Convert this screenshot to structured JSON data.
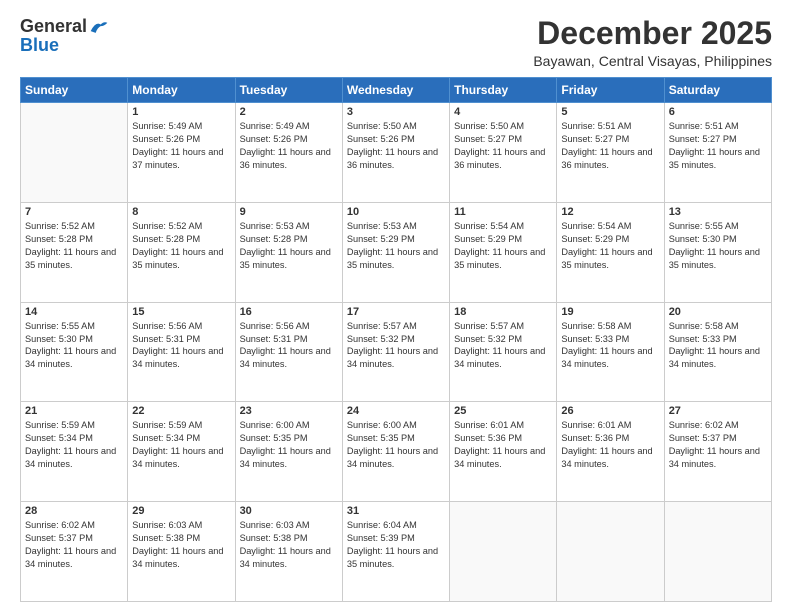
{
  "header": {
    "logo_general": "General",
    "logo_blue": "Blue",
    "month_title": "December 2025",
    "subtitle": "Bayawan, Central Visayas, Philippines"
  },
  "weekdays": [
    "Sunday",
    "Monday",
    "Tuesday",
    "Wednesday",
    "Thursday",
    "Friday",
    "Saturday"
  ],
  "weeks": [
    [
      {
        "day": null,
        "sunrise": null,
        "sunset": null,
        "daylight": null
      },
      {
        "day": "1",
        "sunrise": "Sunrise: 5:49 AM",
        "sunset": "Sunset: 5:26 PM",
        "daylight": "Daylight: 11 hours and 37 minutes."
      },
      {
        "day": "2",
        "sunrise": "Sunrise: 5:49 AM",
        "sunset": "Sunset: 5:26 PM",
        "daylight": "Daylight: 11 hours and 36 minutes."
      },
      {
        "day": "3",
        "sunrise": "Sunrise: 5:50 AM",
        "sunset": "Sunset: 5:26 PM",
        "daylight": "Daylight: 11 hours and 36 minutes."
      },
      {
        "day": "4",
        "sunrise": "Sunrise: 5:50 AM",
        "sunset": "Sunset: 5:27 PM",
        "daylight": "Daylight: 11 hours and 36 minutes."
      },
      {
        "day": "5",
        "sunrise": "Sunrise: 5:51 AM",
        "sunset": "Sunset: 5:27 PM",
        "daylight": "Daylight: 11 hours and 36 minutes."
      },
      {
        "day": "6",
        "sunrise": "Sunrise: 5:51 AM",
        "sunset": "Sunset: 5:27 PM",
        "daylight": "Daylight: 11 hours and 35 minutes."
      }
    ],
    [
      {
        "day": "7",
        "sunrise": "Sunrise: 5:52 AM",
        "sunset": "Sunset: 5:28 PM",
        "daylight": "Daylight: 11 hours and 35 minutes."
      },
      {
        "day": "8",
        "sunrise": "Sunrise: 5:52 AM",
        "sunset": "Sunset: 5:28 PM",
        "daylight": "Daylight: 11 hours and 35 minutes."
      },
      {
        "day": "9",
        "sunrise": "Sunrise: 5:53 AM",
        "sunset": "Sunset: 5:28 PM",
        "daylight": "Daylight: 11 hours and 35 minutes."
      },
      {
        "day": "10",
        "sunrise": "Sunrise: 5:53 AM",
        "sunset": "Sunset: 5:29 PM",
        "daylight": "Daylight: 11 hours and 35 minutes."
      },
      {
        "day": "11",
        "sunrise": "Sunrise: 5:54 AM",
        "sunset": "Sunset: 5:29 PM",
        "daylight": "Daylight: 11 hours and 35 minutes."
      },
      {
        "day": "12",
        "sunrise": "Sunrise: 5:54 AM",
        "sunset": "Sunset: 5:29 PM",
        "daylight": "Daylight: 11 hours and 35 minutes."
      },
      {
        "day": "13",
        "sunrise": "Sunrise: 5:55 AM",
        "sunset": "Sunset: 5:30 PM",
        "daylight": "Daylight: 11 hours and 35 minutes."
      }
    ],
    [
      {
        "day": "14",
        "sunrise": "Sunrise: 5:55 AM",
        "sunset": "Sunset: 5:30 PM",
        "daylight": "Daylight: 11 hours and 34 minutes."
      },
      {
        "day": "15",
        "sunrise": "Sunrise: 5:56 AM",
        "sunset": "Sunset: 5:31 PM",
        "daylight": "Daylight: 11 hours and 34 minutes."
      },
      {
        "day": "16",
        "sunrise": "Sunrise: 5:56 AM",
        "sunset": "Sunset: 5:31 PM",
        "daylight": "Daylight: 11 hours and 34 minutes."
      },
      {
        "day": "17",
        "sunrise": "Sunrise: 5:57 AM",
        "sunset": "Sunset: 5:32 PM",
        "daylight": "Daylight: 11 hours and 34 minutes."
      },
      {
        "day": "18",
        "sunrise": "Sunrise: 5:57 AM",
        "sunset": "Sunset: 5:32 PM",
        "daylight": "Daylight: 11 hours and 34 minutes."
      },
      {
        "day": "19",
        "sunrise": "Sunrise: 5:58 AM",
        "sunset": "Sunset: 5:33 PM",
        "daylight": "Daylight: 11 hours and 34 minutes."
      },
      {
        "day": "20",
        "sunrise": "Sunrise: 5:58 AM",
        "sunset": "Sunset: 5:33 PM",
        "daylight": "Daylight: 11 hours and 34 minutes."
      }
    ],
    [
      {
        "day": "21",
        "sunrise": "Sunrise: 5:59 AM",
        "sunset": "Sunset: 5:34 PM",
        "daylight": "Daylight: 11 hours and 34 minutes."
      },
      {
        "day": "22",
        "sunrise": "Sunrise: 5:59 AM",
        "sunset": "Sunset: 5:34 PM",
        "daylight": "Daylight: 11 hours and 34 minutes."
      },
      {
        "day": "23",
        "sunrise": "Sunrise: 6:00 AM",
        "sunset": "Sunset: 5:35 PM",
        "daylight": "Daylight: 11 hours and 34 minutes."
      },
      {
        "day": "24",
        "sunrise": "Sunrise: 6:00 AM",
        "sunset": "Sunset: 5:35 PM",
        "daylight": "Daylight: 11 hours and 34 minutes."
      },
      {
        "day": "25",
        "sunrise": "Sunrise: 6:01 AM",
        "sunset": "Sunset: 5:36 PM",
        "daylight": "Daylight: 11 hours and 34 minutes."
      },
      {
        "day": "26",
        "sunrise": "Sunrise: 6:01 AM",
        "sunset": "Sunset: 5:36 PM",
        "daylight": "Daylight: 11 hours and 34 minutes."
      },
      {
        "day": "27",
        "sunrise": "Sunrise: 6:02 AM",
        "sunset": "Sunset: 5:37 PM",
        "daylight": "Daylight: 11 hours and 34 minutes."
      }
    ],
    [
      {
        "day": "28",
        "sunrise": "Sunrise: 6:02 AM",
        "sunset": "Sunset: 5:37 PM",
        "daylight": "Daylight: 11 hours and 34 minutes."
      },
      {
        "day": "29",
        "sunrise": "Sunrise: 6:03 AM",
        "sunset": "Sunset: 5:38 PM",
        "daylight": "Daylight: 11 hours and 34 minutes."
      },
      {
        "day": "30",
        "sunrise": "Sunrise: 6:03 AM",
        "sunset": "Sunset: 5:38 PM",
        "daylight": "Daylight: 11 hours and 34 minutes."
      },
      {
        "day": "31",
        "sunrise": "Sunrise: 6:04 AM",
        "sunset": "Sunset: 5:39 PM",
        "daylight": "Daylight: 11 hours and 35 minutes."
      },
      {
        "day": null,
        "sunrise": null,
        "sunset": null,
        "daylight": null
      },
      {
        "day": null,
        "sunrise": null,
        "sunset": null,
        "daylight": null
      },
      {
        "day": null,
        "sunrise": null,
        "sunset": null,
        "daylight": null
      }
    ]
  ]
}
